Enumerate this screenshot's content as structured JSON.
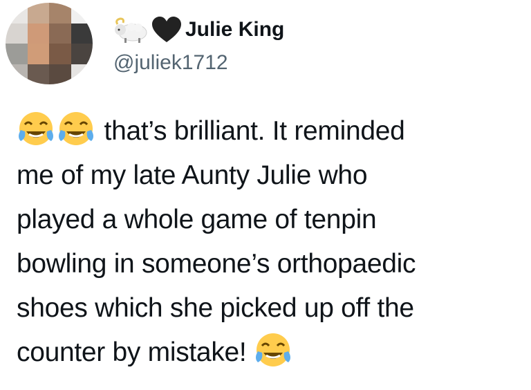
{
  "tweet": {
    "display_name": "Julie King",
    "handle": "@juliek1712",
    "name_icons": [
      "ram-emoji",
      "black-heart-emoji"
    ],
    "avatar": "pixelated-profile-photo",
    "text_lines": [
      "that’s brilliant. It reminded",
      "me of my late Aunty Julie who",
      "played a whole game of tenpin",
      "bowling in someone’s orthopaedic",
      "shoes which she picked up off the",
      "counter by mistake!"
    ],
    "emojis": [
      "face-with-tears-of-joy",
      "face-with-tears-of-joy",
      "face-with-tears-of-joy"
    ]
  },
  "colors": {
    "text": "#0f1419",
    "handle": "#536471",
    "emoji_face": "#ffcc4d",
    "emoji_tears": "#5dadec"
  }
}
